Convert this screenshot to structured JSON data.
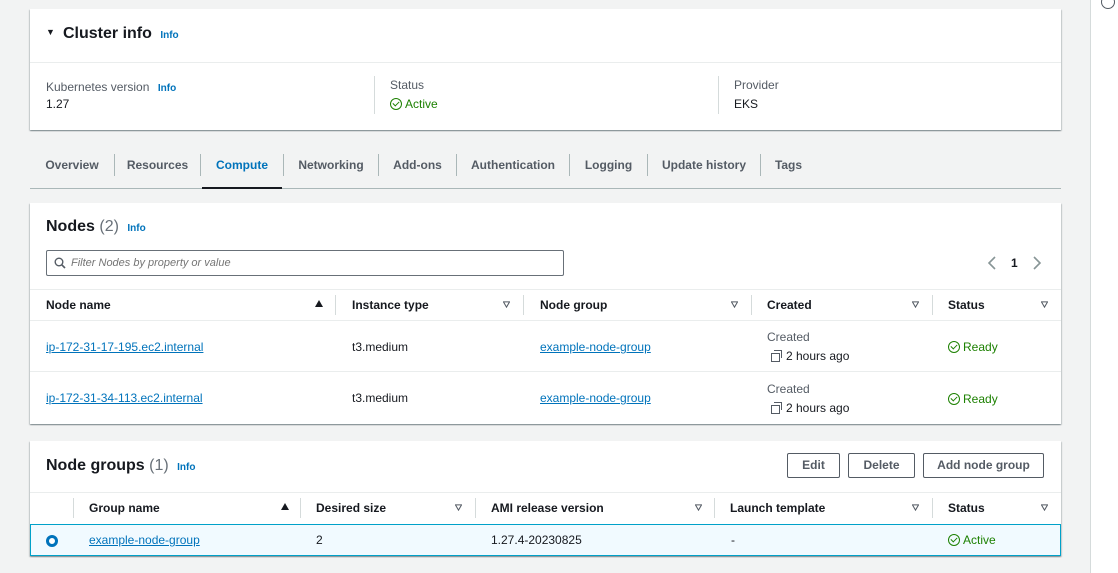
{
  "cluster_info": {
    "title": "Cluster info",
    "info": "Info",
    "kubernetes_version_label": "Kubernetes version",
    "kubernetes_version_info": "Info",
    "kubernetes_version": "1.27",
    "status_label": "Status",
    "status": "Active",
    "provider_label": "Provider",
    "provider": "EKS"
  },
  "tabs": [
    "Overview",
    "Resources",
    "Compute",
    "Networking",
    "Add-ons",
    "Authentication",
    "Logging",
    "Update history",
    "Tags"
  ],
  "active_tab": "Compute",
  "nodes": {
    "title": "Nodes",
    "count": "(2)",
    "info": "Info",
    "filter_placeholder": "Filter Nodes by property or value",
    "page": "1",
    "columns": [
      "Node name",
      "Instance type",
      "Node group",
      "Created",
      "Status"
    ],
    "rows": [
      {
        "name": "ip-172-31-17-195.ec2.internal",
        "instance_type": "t3.medium",
        "node_group": "example-node-group",
        "created_label": "Created",
        "created": "2 hours ago",
        "status": "Ready"
      },
      {
        "name": "ip-172-31-34-113.ec2.internal",
        "instance_type": "t3.medium",
        "node_group": "example-node-group",
        "created_label": "Created",
        "created": "2 hours ago",
        "status": "Ready"
      }
    ]
  },
  "node_groups": {
    "title": "Node groups",
    "count": "(1)",
    "info": "Info",
    "edit_label": "Edit",
    "delete_label": "Delete",
    "add_label": "Add node group",
    "columns": [
      "Group name",
      "Desired size",
      "AMI release version",
      "Launch template",
      "Status"
    ],
    "rows": [
      {
        "name": "example-node-group",
        "desired_size": "2",
        "ami_release": "1.27.4-20230825",
        "launch_template": "-",
        "status": "Active"
      }
    ]
  },
  "colors": {
    "link": "#0073bb",
    "success": "#1d8102",
    "background": "#f2f3f3"
  }
}
